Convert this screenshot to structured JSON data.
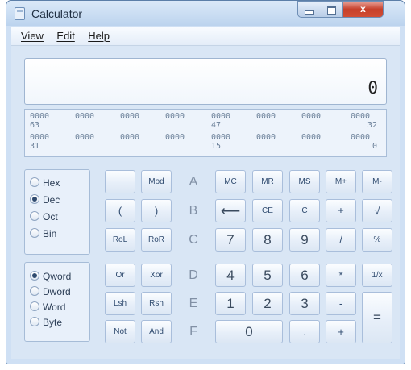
{
  "window": {
    "title": "Calculator",
    "controls": {
      "minimize": "",
      "maximize": "",
      "close": "x"
    }
  },
  "menu": [
    "View",
    "Edit",
    "Help"
  ],
  "display": {
    "value": "0"
  },
  "binary_display": {
    "row1": [
      "0000",
      "0000",
      "0000",
      "0000",
      "0000",
      "0000",
      "0000",
      "0000"
    ],
    "row1_labels": [
      "63",
      "47",
      "32"
    ],
    "row2": [
      "0000",
      "0000",
      "0000",
      "0000",
      "0000",
      "0000",
      "0000",
      "0000"
    ],
    "row2_labels": [
      "31",
      "15",
      "0"
    ]
  },
  "base_options": [
    {
      "label": "Hex",
      "checked": false
    },
    {
      "label": "Dec",
      "checked": true
    },
    {
      "label": "Oct",
      "checked": false
    },
    {
      "label": "Bin",
      "checked": false
    }
  ],
  "word_options": [
    {
      "label": "Qword",
      "checked": true
    },
    {
      "label": "Dword",
      "checked": false
    },
    {
      "label": "Word",
      "checked": false
    },
    {
      "label": "Byte",
      "checked": false
    }
  ],
  "buttons": {
    "blank": "",
    "mod": "Mod",
    "hex_a": "A",
    "mc": "MC",
    "mr": "MR",
    "ms": "MS",
    "mplus": "M+",
    "mminus": "M-",
    "lparen": "(",
    "rparen": ")",
    "hex_b": "B",
    "backspace": "⟵",
    "ce": "CE",
    "c": "C",
    "plusminus": "±",
    "sqrt": "√",
    "rol": "RoL",
    "ror": "RoR",
    "hex_c": "C",
    "n7": "7",
    "n8": "8",
    "n9": "9",
    "divide": "/",
    "percent": "%",
    "or": "Or",
    "xor": "Xor",
    "hex_d": "D",
    "n4": "4",
    "n5": "5",
    "n6": "6",
    "multiply": "*",
    "reciprocal": "1/x",
    "lsh": "Lsh",
    "rsh": "Rsh",
    "hex_e": "E",
    "n1": "1",
    "n2": "2",
    "n3": "3",
    "minus": "-",
    "equals": "=",
    "not": "Not",
    "and": "And",
    "hex_f": "F",
    "n0": "0",
    "decimal": ".",
    "plus": "+"
  }
}
